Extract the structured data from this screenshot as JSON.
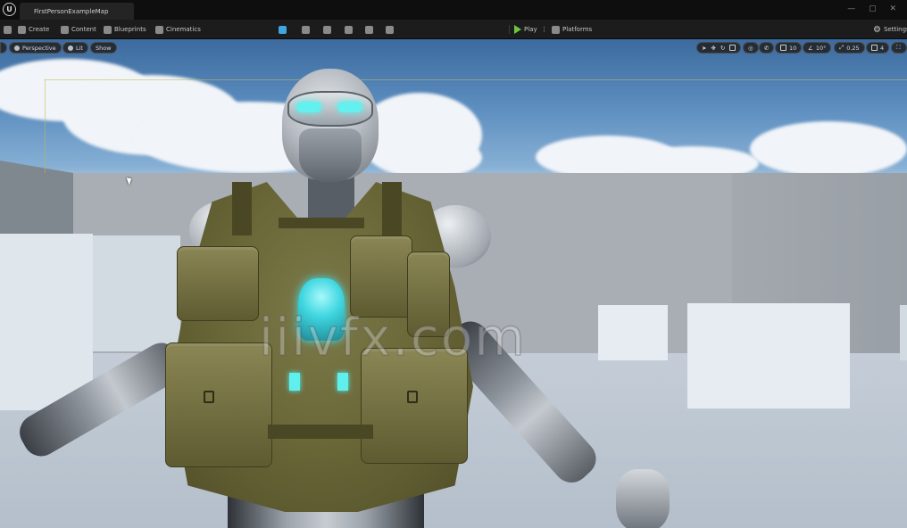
{
  "window": {
    "logo": "U",
    "map_tab": "FirstPersonExampleMap",
    "controls": "— ▢ ✕"
  },
  "toolbar": {
    "create": "Create",
    "content": "Content",
    "blueprints": "Blueprints",
    "cinematics": "Cinematics",
    "play": "Play",
    "platforms": "Platforms",
    "settings": "Settings"
  },
  "viewport": {
    "perspective": "Perspective",
    "lit": "Lit",
    "show": "Show",
    "grid_snap": "10",
    "rotation_snap": "10°",
    "scale_snap": "0.25",
    "camera_speed": "4",
    "watermark": "iiivfx.com"
  },
  "colors": {
    "accent_play": "#6dc441",
    "accent_blue": "#3fa6e0",
    "glow": "#64f0ee"
  }
}
